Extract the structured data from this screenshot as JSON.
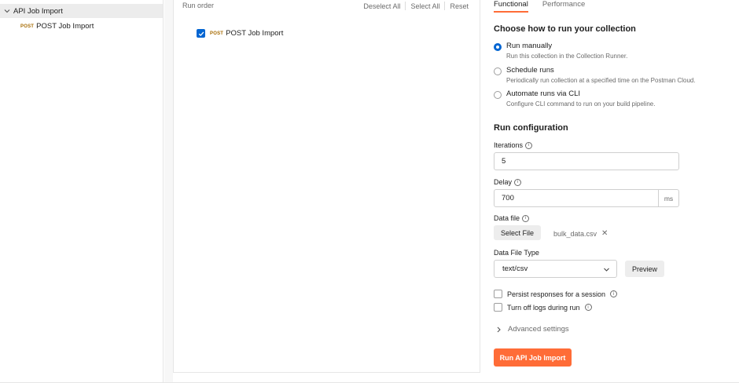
{
  "sidebar": {
    "collection_name": "API Job Import",
    "request": {
      "method": "POST",
      "name": "POST Job Import"
    }
  },
  "run_order": {
    "title": "Run order",
    "actions": {
      "deselect_all": "Deselect All",
      "select_all": "Select All",
      "reset": "Reset"
    },
    "items": [
      {
        "method": "POST",
        "name": "POST Job Import",
        "checked": true
      }
    ]
  },
  "tabs": [
    {
      "label": "Functional",
      "active": true
    },
    {
      "label": "Performance",
      "active": false
    }
  ],
  "run_mode": {
    "heading": "Choose how to run your collection",
    "options": [
      {
        "label": "Run manually",
        "description": "Run this collection in the Collection Runner.",
        "selected": true
      },
      {
        "label": "Schedule runs",
        "description": "Periodically run collection at a specified time on the Postman Cloud.",
        "selected": false
      },
      {
        "label": "Automate runs via CLI",
        "description": "Configure CLI command to run on your build pipeline.",
        "selected": false
      }
    ]
  },
  "config": {
    "heading": "Run configuration",
    "iterations": {
      "label": "Iterations",
      "value": "5"
    },
    "delay": {
      "label": "Delay",
      "value": "700",
      "unit": "ms"
    },
    "data_file": {
      "label": "Data file",
      "button": "Select File",
      "file_name": "bulk_data.csv"
    },
    "data_file_type": {
      "label": "Data File Type",
      "value": "text/csv",
      "preview_button": "Preview"
    },
    "persist_responses": {
      "label": "Persist responses for a session",
      "checked": false
    },
    "turn_off_logs": {
      "label": "Turn off logs during run",
      "checked": false
    },
    "advanced_settings": "Advanced settings",
    "run_button": "Run API Job Import"
  },
  "colors": {
    "accent": "#ff6c37",
    "primary_blue": "#0265d2",
    "method_post": "#a66a00"
  }
}
